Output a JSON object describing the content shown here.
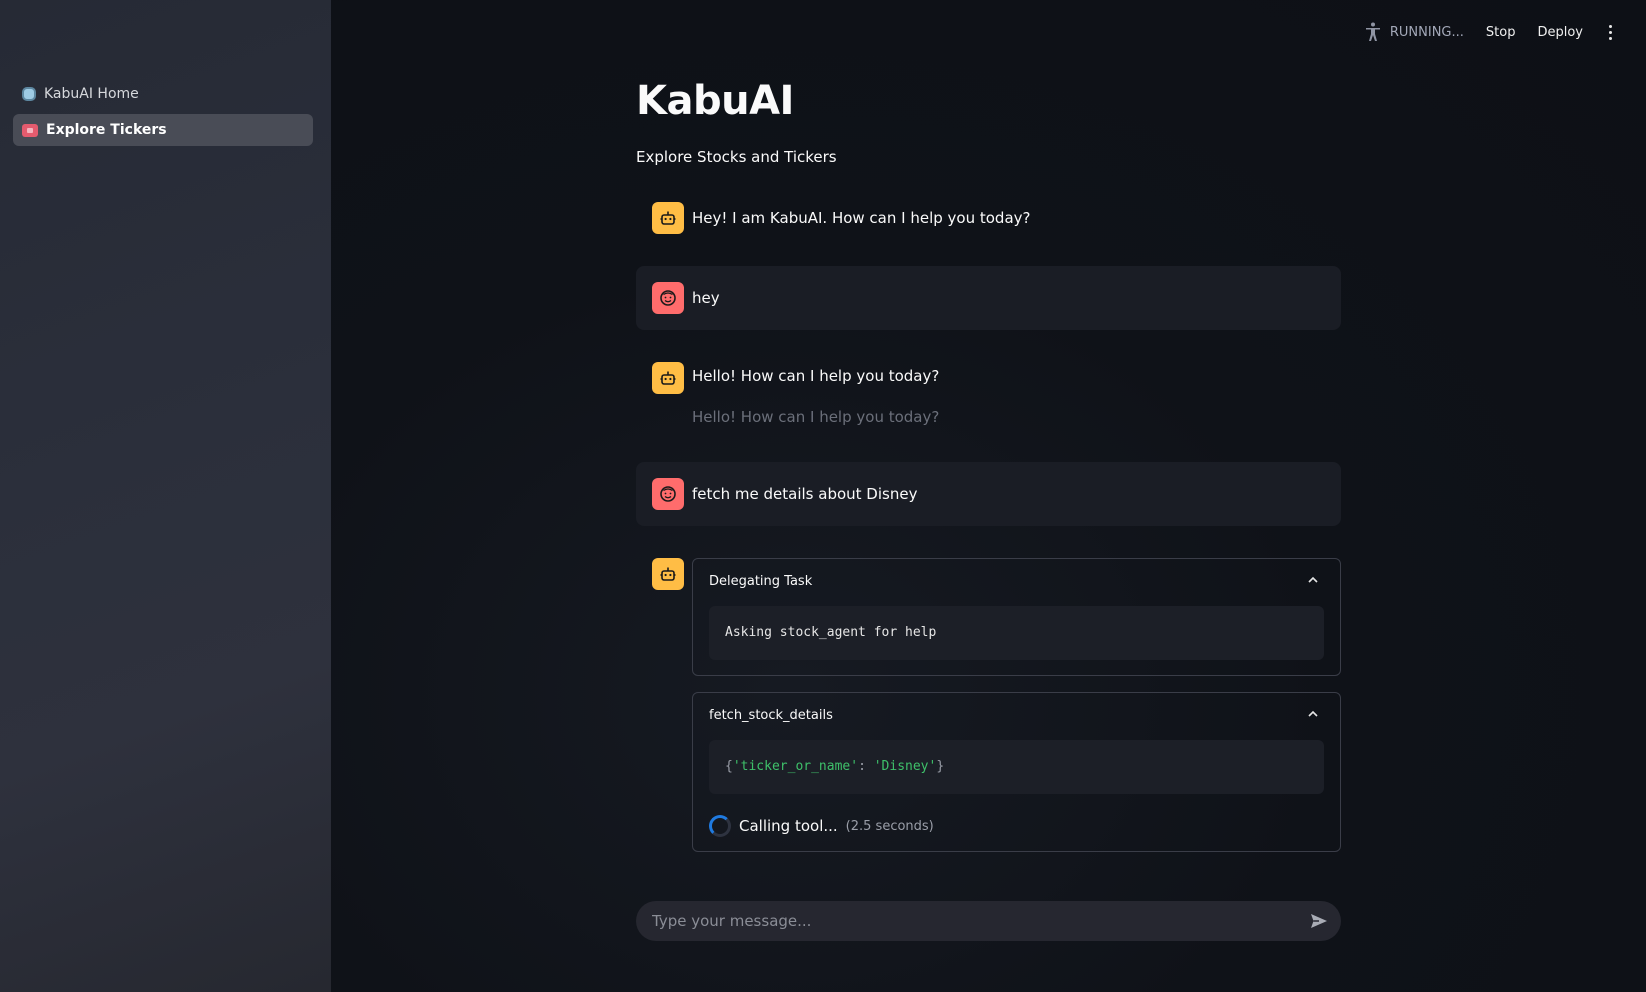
{
  "sidebar": {
    "items": [
      {
        "label": "KabuAI Home",
        "icon": "robot-icon",
        "active": false
      },
      {
        "label": "Explore Tickers",
        "icon": "ticket-icon",
        "active": true
      }
    ]
  },
  "toolbar": {
    "status": "RUNNING...",
    "stop_label": "Stop",
    "deploy_label": "Deploy"
  },
  "main": {
    "title": "KabuAI",
    "subtitle": "Explore Stocks and Tickers"
  },
  "messages": [
    {
      "role": "assistant",
      "text": "Hey! I am KabuAI. How can I help you today?"
    },
    {
      "role": "user",
      "text": "hey"
    },
    {
      "role": "assistant",
      "text": "Hello! How can I help you today?",
      "echo": "Hello! How can I help you today?"
    },
    {
      "role": "user",
      "text": "fetch me details about Disney"
    }
  ],
  "tool_steps": {
    "delegate": {
      "header": "Delegating Task",
      "code": "Asking stock_agent for help"
    },
    "fetch": {
      "header": "fetch_stock_details",
      "code_open": "{",
      "code_key": "'ticker_or_name'",
      "code_sep": ": ",
      "code_value": "'Disney'",
      "code_close": "}",
      "status": "Calling tool...",
      "elapsed": "(2.5 seconds)"
    }
  },
  "chat_input": {
    "placeholder": "Type your message..."
  },
  "colors": {
    "bot_avatar": "#ffbd45",
    "user_avatar": "#ff6c6c",
    "spinner": "#1f7ae0",
    "code_string": "#3ec06a"
  }
}
